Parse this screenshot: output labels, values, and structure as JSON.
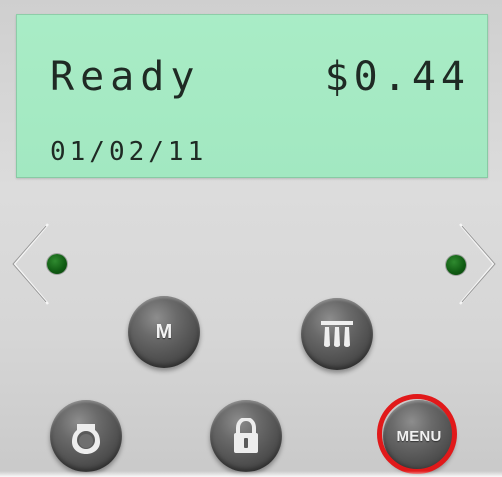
{
  "display": {
    "status": "Ready",
    "amount": "$0.44",
    "date": "01/02/11"
  },
  "navigation": {
    "left_icon": "chevron-left-icon",
    "right_icon": "chevron-right-icon"
  },
  "buttons": {
    "m_label": "M",
    "menu_label": "MENU",
    "scale_icon": "scale-icon",
    "bell_icon": "bell-icon",
    "lock_icon": "lock-icon"
  },
  "colors": {
    "lcd_background": "#a6eac3",
    "led": "#1a6e1c",
    "menu_highlight": "#e1191a"
  }
}
